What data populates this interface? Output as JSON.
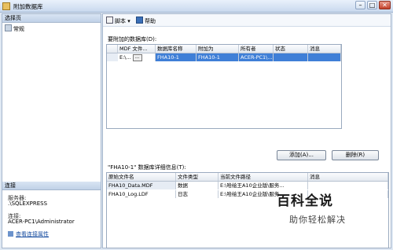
{
  "window": {
    "title": "附加数据库"
  },
  "left_pane": {
    "select_page_header": "选择页",
    "pages": [
      {
        "label": "常规"
      }
    ],
    "connection_header": "连接",
    "server_label": "服务器:",
    "server_value": ".\\SQLEXPRESS",
    "connection_label": "连接:",
    "connection_value": "ACER-PC1\\Administrator",
    "view_props_link": "查看连接属性"
  },
  "toolbar": {
    "script_label": "脚本",
    "help_label": "帮助"
  },
  "attach_section": {
    "label": "要附加的数据库(D):",
    "columns": [
      "MDF 文件...",
      "数据库名称",
      "附加为",
      "所有者",
      "状态",
      "消息"
    ],
    "rows": [
      {
        "mdf": "E:\\...",
        "db_name": "FHA10-1",
        "attach_as": "FHA10-1",
        "owner": "ACER-PC1\\...",
        "status": "",
        "message": ""
      }
    ]
  },
  "buttons": {
    "add": "添加(A)...",
    "remove": "删除(R)",
    "browse": "..."
  },
  "detail_section": {
    "label": "\"FHA10-1\" 数据库详细信息(T):",
    "columns": [
      "原始文件名",
      "文件类型",
      "当前文件路径",
      "消息"
    ],
    "rows": [
      {
        "orig": "FHA10_Data.MDF",
        "type": "数据",
        "path": "E:\\哈绘王A10企业版\\服务...",
        "msg": ""
      },
      {
        "orig": "FHA10_Log.LDF",
        "type": "日志",
        "path": "E:\\哈绘王A10企业版\\服务...",
        "msg": ""
      }
    ]
  },
  "watermark": {
    "logo": "百科全说",
    "sub": "助你轻松解决"
  }
}
